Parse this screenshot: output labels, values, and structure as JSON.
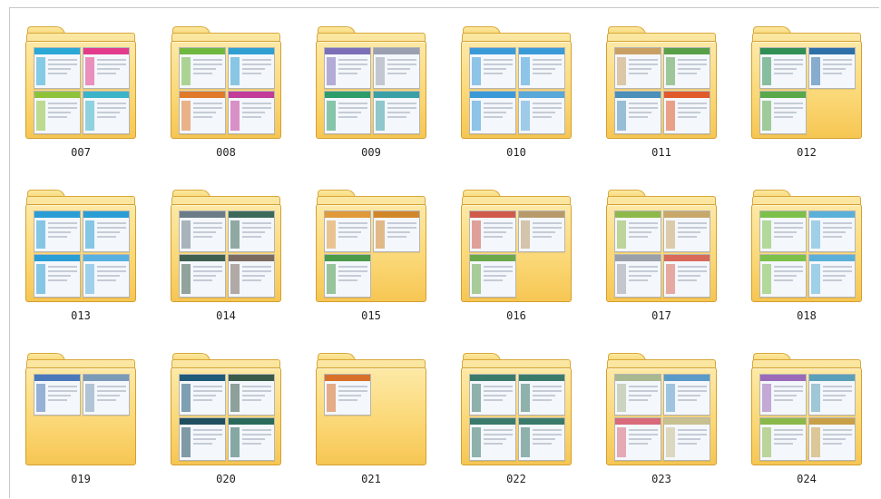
{
  "folders": [
    {
      "label": "007",
      "color": "#29a8d6",
      "thumbs": [
        {
          "c": "#29a8d6"
        },
        {
          "c": "#e33b8c"
        },
        {
          "c": "#8fc23b"
        },
        {
          "c": "#3bb4c9"
        }
      ]
    },
    {
      "label": "008",
      "color": "#6fb840",
      "thumbs": [
        {
          "c": "#6fb840"
        },
        {
          "c": "#2f9fd1"
        },
        {
          "c": "#e07a2b"
        },
        {
          "c": "#c23c9a"
        }
      ]
    },
    {
      "label": "009",
      "color": "#7c6fb8",
      "thumbs": [
        {
          "c": "#7c6fb8"
        },
        {
          "c": "#9aa0b0"
        },
        {
          "c": "#2e9d6a"
        },
        {
          "c": "#3aa0a6"
        }
      ]
    },
    {
      "label": "010",
      "color": "#3a9ad8",
      "thumbs": [
        {
          "c": "#3a9ad8"
        },
        {
          "c": "#3a9ad8"
        },
        {
          "c": "#3a9ad8"
        },
        {
          "c": "#58a8d8"
        }
      ]
    },
    {
      "label": "011",
      "color": "#c9a064",
      "thumbs": [
        {
          "c": "#c9a064"
        },
        {
          "c": "#58a048"
        },
        {
          "c": "#4a90b8"
        },
        {
          "c": "#e05a2b"
        }
      ]
    },
    {
      "label": "012",
      "color": "#2f8f55",
      "thumbs": [
        {
          "c": "#2f8f55"
        },
        {
          "c": "#2d6fa8"
        },
        {
          "c": "#5aa84a"
        }
      ]
    },
    {
      "label": "013",
      "color": "#2a9ed4",
      "thumbs": [
        {
          "c": "#2a9ed4"
        },
        {
          "c": "#2a9ed4"
        },
        {
          "c": "#2a9ed4"
        },
        {
          "c": "#58b0e0"
        }
      ]
    },
    {
      "label": "014",
      "color": "#5a6a78",
      "thumbs": [
        {
          "c": "#6b7b88"
        },
        {
          "c": "#3c6a5a"
        },
        {
          "c": "#3f5f4f"
        },
        {
          "c": "#7a6a60"
        }
      ]
    },
    {
      "label": "015",
      "color": "#e09a3a",
      "thumbs": [
        {
          "c": "#e09a3a"
        },
        {
          "c": "#d2862a"
        },
        {
          "c": "#4a9a4a"
        }
      ]
    },
    {
      "label": "016",
      "color": "#6aa84a",
      "thumbs": [
        {
          "c": "#d05a4a"
        },
        {
          "c": "#b89a6a"
        },
        {
          "c": "#6aa84a"
        }
      ]
    },
    {
      "label": "017",
      "color": "#8fb84a",
      "thumbs": [
        {
          "c": "#8fb84a"
        },
        {
          "c": "#c8a86a"
        },
        {
          "c": "#9aa0a8"
        },
        {
          "c": "#d86a5a"
        }
      ]
    },
    {
      "label": "018",
      "color": "#7cc04a",
      "thumbs": [
        {
          "c": "#7cc04a"
        },
        {
          "c": "#5ab0d8"
        },
        {
          "c": "#7cc04a"
        },
        {
          "c": "#5ab0d8"
        }
      ]
    },
    {
      "label": "019",
      "color": "#4a78b8",
      "thumbs": [
        {
          "c": "#4a78b8"
        },
        {
          "c": "#7a9ab8"
        }
      ]
    },
    {
      "label": "020",
      "color": "#1f5a78",
      "thumbs": [
        {
          "c": "#1f5a78"
        },
        {
          "c": "#3a5a4a"
        },
        {
          "c": "#1f4f5f"
        },
        {
          "c": "#2a6a5a"
        }
      ]
    },
    {
      "label": "021",
      "color": "#d8702a",
      "thumbs": [
        {
          "c": "#d8702a"
        }
      ]
    },
    {
      "label": "022",
      "color": "#3a7a6a",
      "thumbs": [
        {
          "c": "#3a7a6a"
        },
        {
          "c": "#3a7a6a"
        },
        {
          "c": "#3a7a6a"
        },
        {
          "c": "#3a7a6a"
        }
      ]
    },
    {
      "label": "023",
      "color": "#b8c8a0",
      "thumbs": [
        {
          "c": "#a8b890"
        },
        {
          "c": "#5a9ac8"
        },
        {
          "c": "#d86a7a"
        },
        {
          "c": "#c8c090"
        }
      ]
    },
    {
      "label": "024",
      "color": "#9a6ab8",
      "thumbs": [
        {
          "c": "#9a6ab8"
        },
        {
          "c": "#5aa0b8"
        },
        {
          "c": "#8ab84a"
        },
        {
          "c": "#c8a048"
        }
      ]
    }
  ]
}
